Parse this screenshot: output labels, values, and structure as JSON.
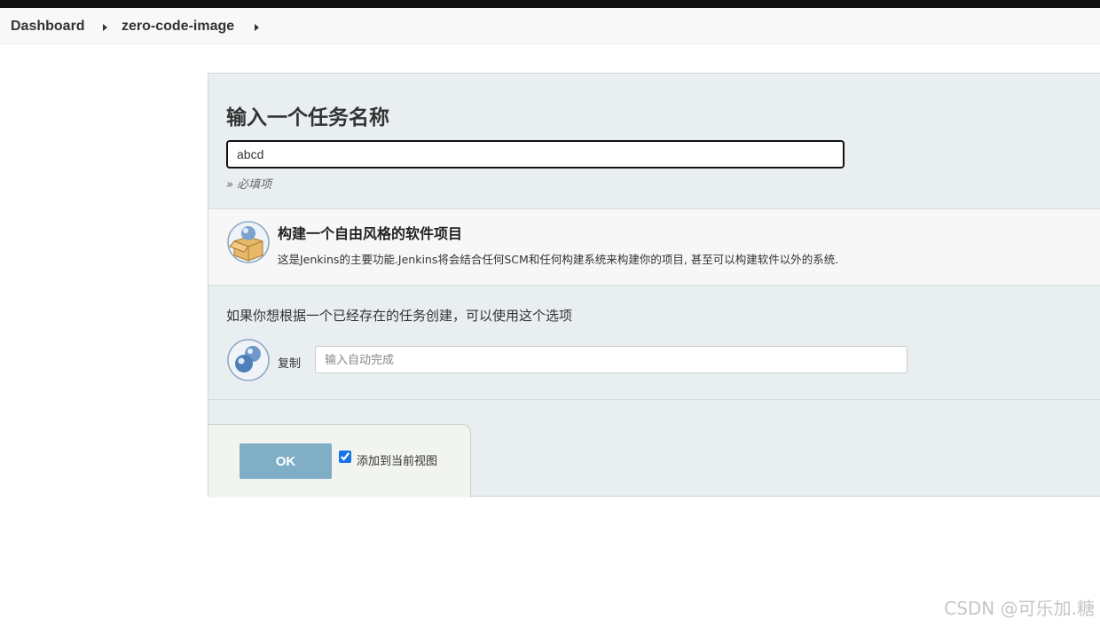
{
  "breadcrumb": {
    "items": [
      {
        "label": "Dashboard"
      },
      {
        "label": "zero-code-image"
      }
    ]
  },
  "form": {
    "title": "输入一个任务名称",
    "name_value": "abcd",
    "required_hint": "» 必填项"
  },
  "job_types": [
    {
      "title": "构建一个自由风格的软件项目",
      "description": "这是Jenkins的主要功能.Jenkins将会结合任何SCM和任何构建系统来构建你的项目, 甚至可以构建软件以外的系统.",
      "icon": "freestyle-project-icon"
    }
  ],
  "copy": {
    "hint": "如果你想根据一个已经存在的任务创建，可以使用这个选项",
    "label": "复制",
    "placeholder": "输入自动完成",
    "icon": "copy-job-icon"
  },
  "footer": {
    "ok_label": "OK",
    "add_to_view_label": "添加到当前视图",
    "add_to_view_checked": true
  },
  "colors": {
    "ok_button": "#7faec6",
    "panel_bg": "#e9eef0",
    "topbar": "#111111"
  },
  "watermark": "CSDN @可乐加.糖"
}
